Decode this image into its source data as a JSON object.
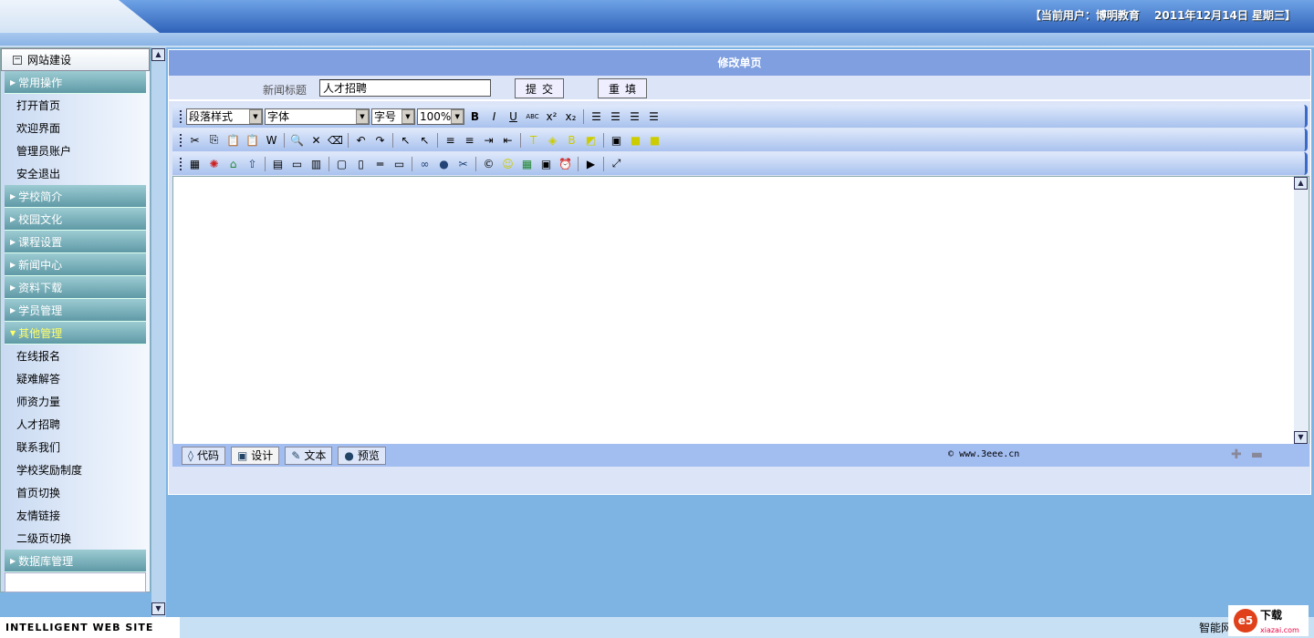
{
  "header": {
    "user_info": "【当前用户：博明教育　 2011年12月14日 星期三】"
  },
  "sidebar": {
    "title": "网站建设",
    "groups": [
      {
        "label": "常用操作",
        "open": true,
        "items": [
          "打开首页",
          "欢迎界面",
          "管理员账户",
          "安全退出"
        ]
      },
      {
        "label": "学校简介",
        "items": []
      },
      {
        "label": "校园文化",
        "items": []
      },
      {
        "label": "课程设置",
        "items": []
      },
      {
        "label": "新闻中心",
        "items": []
      },
      {
        "label": "资料下载",
        "items": []
      },
      {
        "label": "学员管理",
        "items": []
      },
      {
        "label": "其他管理",
        "open": true,
        "highlight": true,
        "items": [
          "在线报名",
          "疑难解答",
          "师资力量",
          "人才招聘",
          "联系我们",
          "学校奖励制度",
          "首页切换",
          "友情链接",
          "二级页切换"
        ]
      },
      {
        "label": "数据库管理",
        "items": []
      }
    ]
  },
  "main": {
    "title": "修改单页",
    "field_label": "新闻标题",
    "field_value": "人才招聘",
    "submit": "提交",
    "reset": "重填"
  },
  "toolbar": {
    "paragraph": "段落样式",
    "font": "字体",
    "size": "字号",
    "zoom": "100%",
    "row1": [
      [
        "bold-icon",
        "B"
      ],
      [
        "italic-icon",
        "I"
      ],
      [
        "underline-icon",
        "U"
      ],
      [
        "strikethrough-icon",
        "ABC"
      ],
      [
        "superscript-icon",
        "x²"
      ],
      [
        "subscript-icon",
        "x₂"
      ],
      [
        "|"
      ],
      [
        "align-left-icon",
        "☰"
      ],
      [
        "align-center-icon",
        "☰"
      ],
      [
        "align-right-icon",
        "☰"
      ],
      [
        "justify-icon",
        "☰"
      ]
    ],
    "row2": [
      [
        "cut-icon",
        "✂"
      ],
      [
        "copy-icon",
        "⎘"
      ],
      [
        "paste-icon",
        "📋"
      ],
      [
        "paste-text-icon",
        "📋"
      ],
      [
        "paste-word-icon",
        "W"
      ],
      [
        "|"
      ],
      [
        "find-icon",
        "🔍"
      ],
      [
        "delete-icon",
        "✕"
      ],
      [
        "eraser-icon",
        "⌫"
      ],
      [
        "|"
      ],
      [
        "undo-icon",
        "↶"
      ],
      [
        "redo-icon",
        "↷"
      ],
      [
        "|"
      ],
      [
        "select-icon",
        "↖"
      ],
      [
        "select-all-icon",
        "↖"
      ],
      [
        "|"
      ],
      [
        "ordered-list-icon",
        "≡"
      ],
      [
        "unordered-list-icon",
        "≡"
      ],
      [
        "indent-icon",
        "⇥"
      ],
      [
        "outdent-icon",
        "⇤"
      ],
      [
        "|"
      ],
      [
        "text-color-icon",
        "T"
      ],
      [
        "bg-color-icon",
        "◈"
      ],
      [
        "back-color-icon",
        "B"
      ],
      [
        "color-picker-icon",
        "◩"
      ],
      [
        "|"
      ],
      [
        "border-icon",
        "▣"
      ],
      [
        "layer-icon",
        "■"
      ],
      [
        "layer-front-icon",
        "■"
      ]
    ],
    "row3": [
      [
        "image-icon",
        "▦"
      ],
      [
        "flash-icon",
        "✺"
      ],
      [
        "media-icon",
        "⌂"
      ],
      [
        "upload-icon",
        "⇧"
      ],
      [
        "|"
      ],
      [
        "table-icon",
        "▤"
      ],
      [
        "form-icon",
        "▭"
      ],
      [
        "div-icon",
        "▥"
      ],
      [
        "|"
      ],
      [
        "marquee-icon",
        "▢"
      ],
      [
        "file-icon",
        "▯"
      ],
      [
        "hr-icon",
        "═"
      ],
      [
        "field-icon",
        "▭"
      ],
      [
        "|"
      ],
      [
        "link-icon",
        "∞"
      ],
      [
        "anchor-icon",
        "●"
      ],
      [
        "unlink-icon",
        "✂"
      ],
      [
        "|"
      ],
      [
        "symbol-icon",
        "©"
      ],
      [
        "emotion-icon",
        "☺"
      ],
      [
        "excel-icon",
        "▦"
      ],
      [
        "date-icon",
        "▣"
      ],
      [
        "time-icon",
        "⏰"
      ],
      [
        "|"
      ],
      [
        "page-break-icon",
        "▶"
      ],
      [
        "|"
      ],
      [
        "fullscreen-icon",
        "⤢"
      ]
    ]
  },
  "modes": [
    {
      "icon": "code-icon",
      "glyph": "◊",
      "label": "代码"
    },
    {
      "icon": "design-icon",
      "glyph": "▣",
      "label": "设计",
      "active": true
    },
    {
      "icon": "text-icon",
      "glyph": "✎",
      "label": "文本"
    },
    {
      "icon": "preview-icon",
      "glyph": "●",
      "label": "预览"
    }
  ],
  "copyright": {
    "symbol": "©",
    "link": "www.3eee.cn"
  },
  "footer": {
    "brand": "INTELLIGENT WEB  SITE",
    "right_text": "智能网",
    "logo": "下载",
    "logo_sub": "xiazai.com"
  }
}
